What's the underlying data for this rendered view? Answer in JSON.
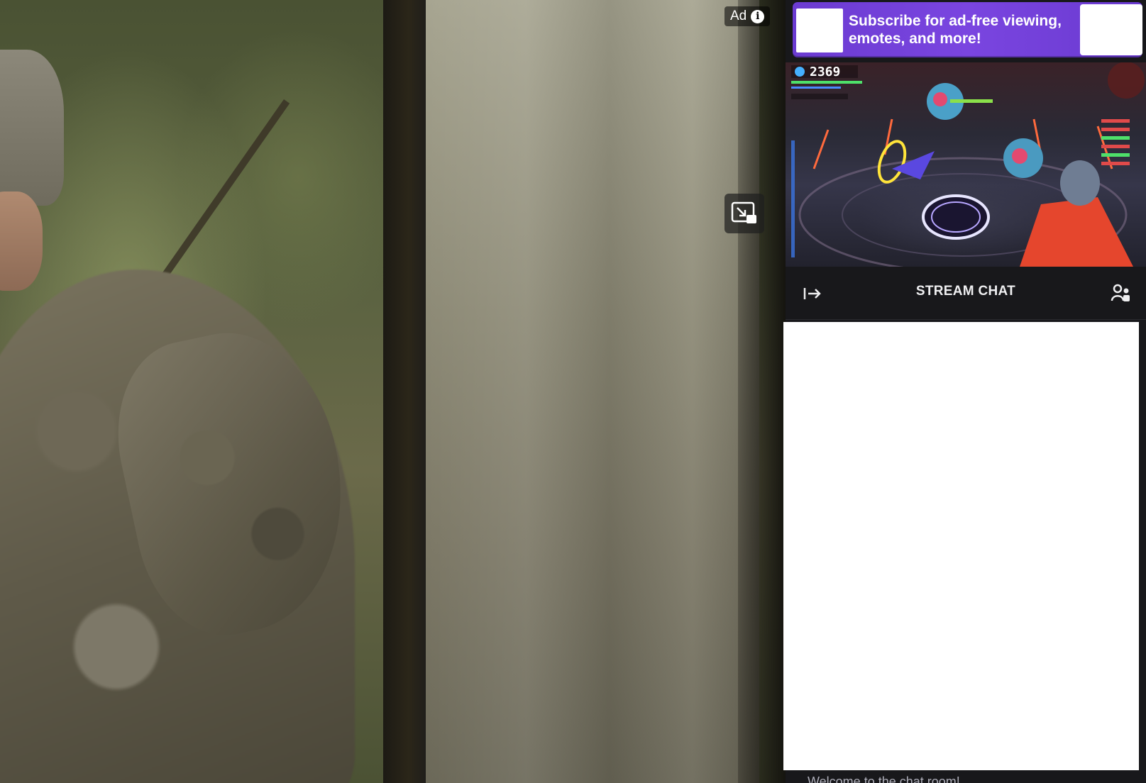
{
  "ad": {
    "label": "Ad",
    "info_glyph": "i"
  },
  "promo": {
    "text": "Subscribe for ad-free viewing, emotes, and more!"
  },
  "mini_player": {
    "score": "2369"
  },
  "chat": {
    "title": "STREAM CHAT",
    "welcome": "Welcome to the chat room!"
  },
  "colors": {
    "promo_purple": "#772ce8",
    "panel_bg": "#18181b",
    "page_bg": "#0e0e10"
  },
  "icons": {
    "ad_info": "info-icon",
    "pip": "picture-in-picture-icon",
    "collapse": "collapse-arrow-icon",
    "users": "community-users-icon"
  }
}
